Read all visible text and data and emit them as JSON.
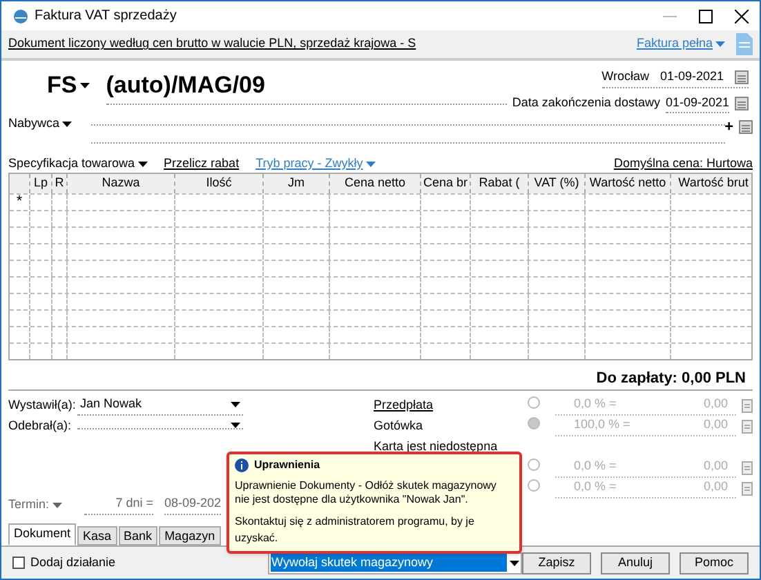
{
  "window": {
    "title": "Faktura VAT sprzedaży"
  },
  "info_bar": {
    "text": "Dokument liczony według cen brutto w walucie PLN, sprzedaż krajowa - S",
    "link": "Faktura pełna"
  },
  "header": {
    "add_symbol": "+",
    "doc_type": "FS",
    "number": "(auto)/MAG/09",
    "place": "Wrocław",
    "issue_date": "01-09-2021",
    "delivery_label": "Data zakończenia dostawy",
    "delivery_date": "01-09-2021",
    "buyer_label": "Nabywca"
  },
  "toolbar": {
    "spec": "Specyfikacja towarowa",
    "recalc": "Przelicz rabat",
    "mode": "Tryb pracy - Zwykły",
    "default_price": "Domyślna cena: Hurtowa"
  },
  "table": {
    "columns": [
      "",
      "Lp",
      "R",
      "Nazwa",
      "Ilość",
      "Jm",
      "Cena netto",
      "Cena br",
      "Rabat (",
      "VAT (%)",
      "Wartość netto",
      "Wartość brut"
    ],
    "new_row_marker": "*"
  },
  "total": "Do zapłaty: 0,00 PLN",
  "people": [
    {
      "label": "Wystawił(a):",
      "value": "Jan Nowak"
    },
    {
      "label": "Odebrał(a):"
    }
  ],
  "payments": [
    {
      "kind": "method",
      "label": "Przedpłata",
      "link": true,
      "selected": false,
      "percent": "0,0 % =",
      "amount": "0,00"
    },
    {
      "kind": "method",
      "label": "Gotówka",
      "link": false,
      "selected": true,
      "percent": "100,0 % =",
      "amount": "0,00"
    },
    {
      "kind": "note",
      "label": "Karta jest niedostępna"
    },
    {
      "kind": "method",
      "selected": false,
      "percent": "0,0 % =",
      "amount": "0,00"
    },
    {
      "kind": "method",
      "selected": false,
      "percent": "0,0 % =",
      "amount": "0,00"
    }
  ],
  "term": {
    "label": "Termin:",
    "days": "7 dni =",
    "date": "08-09-202"
  },
  "tabs": [
    {
      "label": "Dokument",
      "selected": true
    },
    {
      "label": "Kasa",
      "selected": false
    },
    {
      "label": "Bank",
      "selected": false
    },
    {
      "label": "Magazyn",
      "selected": false
    }
  ],
  "add_action": {
    "label": "Dodaj działanie",
    "checked": false
  },
  "action_combo": {
    "value": "Wywołaj skutek magazynowy"
  },
  "buttons": [
    "Zapisz",
    "Anuluj",
    "Pomoc"
  ],
  "tooltip": {
    "title": "Uprawnienia",
    "message": "Uprawnienie Dokumenty - Odłóż skutek magazynowy nie jest dostępne dla użytkownika \"Nowak Jan\".",
    "hint": "Skontaktuj się z administratorem programu, by je uzyskać."
  }
}
